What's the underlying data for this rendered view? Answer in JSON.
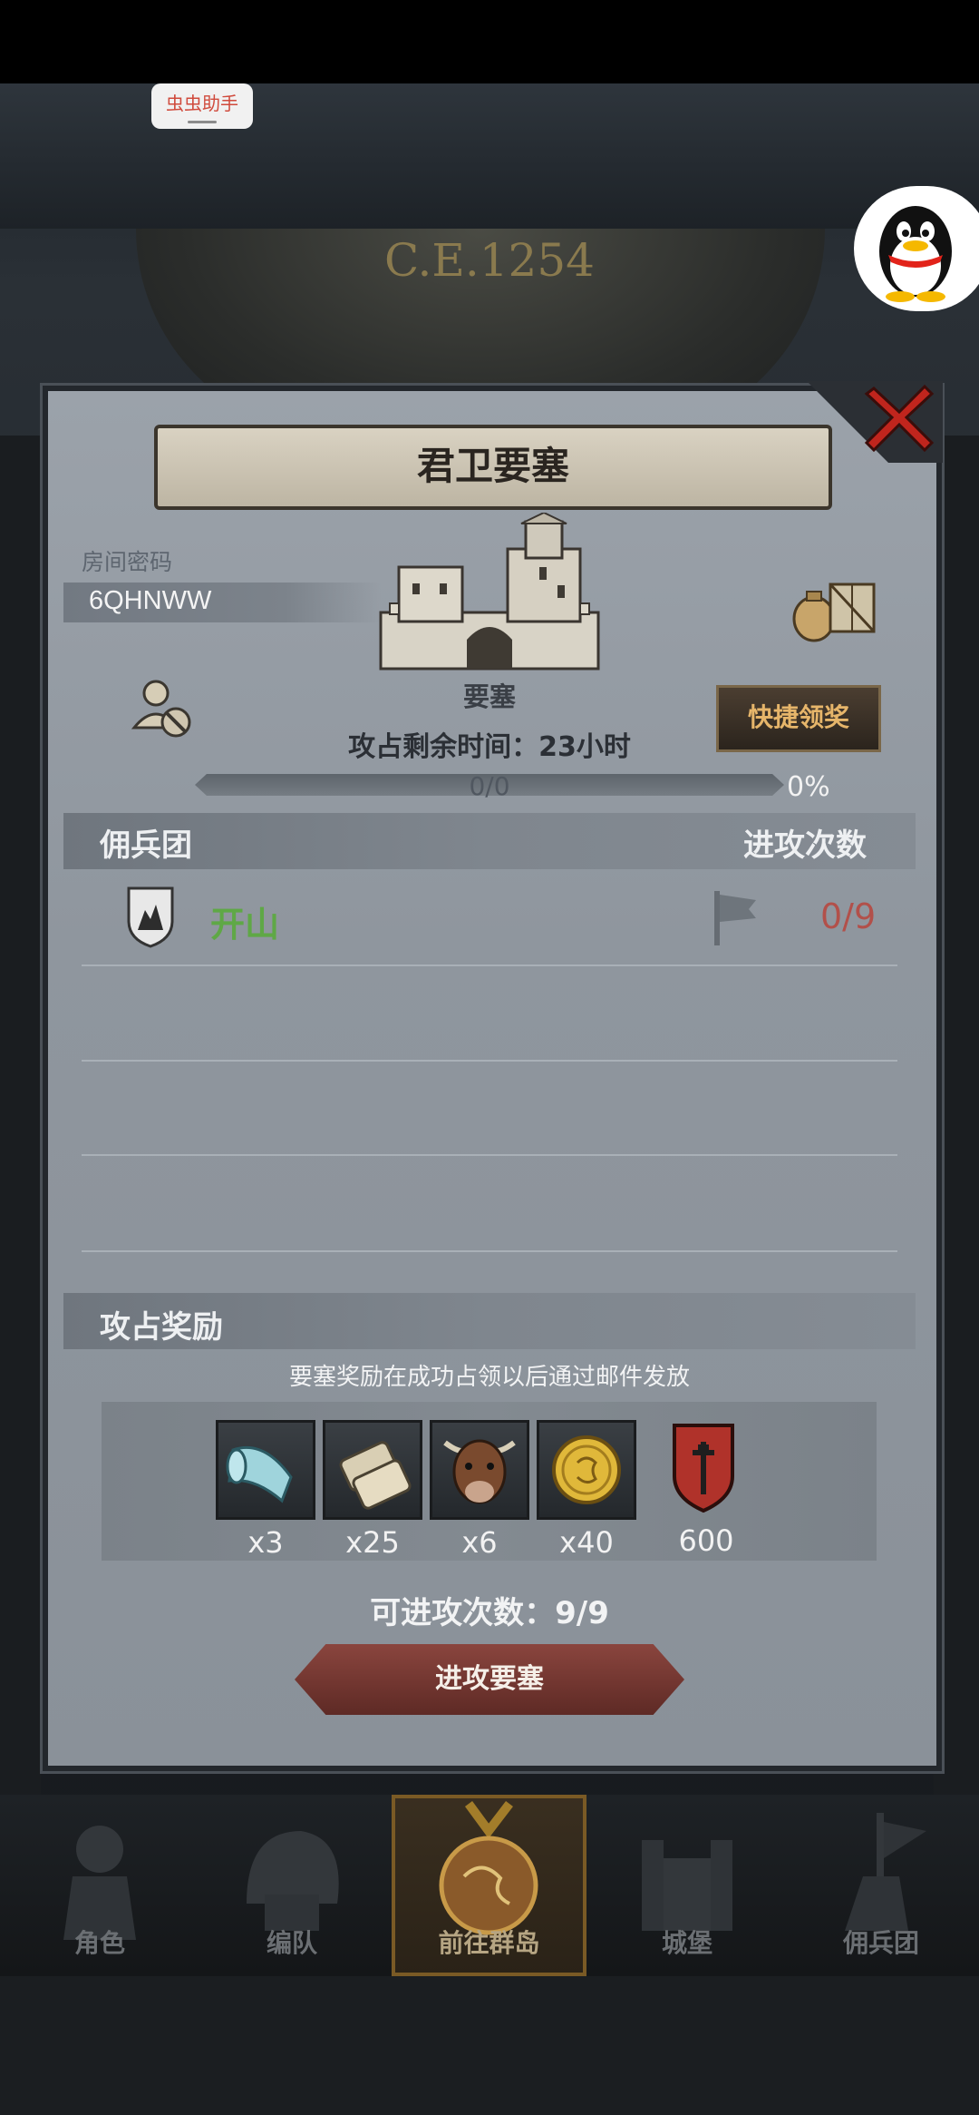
{
  "overlay": {
    "helper_label": "虫虫助手",
    "year_label": "C.E.1254"
  },
  "dialog": {
    "title": "君卫要塞",
    "room": {
      "label": "房间密码",
      "code": "6QHNWW"
    },
    "fortress_name": "要塞",
    "quick_claim_label": "快捷领奖",
    "remaining_time": "攻占剩余时间：23小时",
    "progress": {
      "count_text": "0/0",
      "percent_text": "0%",
      "fraction": 0
    },
    "mercenary_header": "佣兵团",
    "attack_count_header": "进攻次数",
    "mercenaries": [
      {
        "name": "开山",
        "attacks": "0/9"
      }
    ],
    "reward_header": "攻占奖励",
    "reward_note": "要塞奖励在成功占领以后通过邮件发放",
    "rewards": [
      {
        "icon": "cloth-roll-icon",
        "qty": "x3"
      },
      {
        "icon": "scroll-icon",
        "qty": "x25"
      },
      {
        "icon": "ox-icon",
        "qty": "x6"
      },
      {
        "icon": "gold-coin-icon",
        "qty": "x40"
      },
      {
        "icon": "honor-banner-icon",
        "qty": "600"
      }
    ],
    "attempts_text": "可进攻次数：9/9",
    "attack_button_label": "进攻要塞"
  },
  "bottom_nav": [
    {
      "label": "角色",
      "active": false
    },
    {
      "label": "编队",
      "active": false
    },
    {
      "label": "前往群岛",
      "active": true
    },
    {
      "label": "城堡",
      "active": false
    },
    {
      "label": "佣兵团",
      "active": false
    }
  ],
  "colors": {
    "accent_gold": "#e6b56a",
    "merc_name_green": "#5fa846",
    "attack_count_red": "#b2504a"
  }
}
